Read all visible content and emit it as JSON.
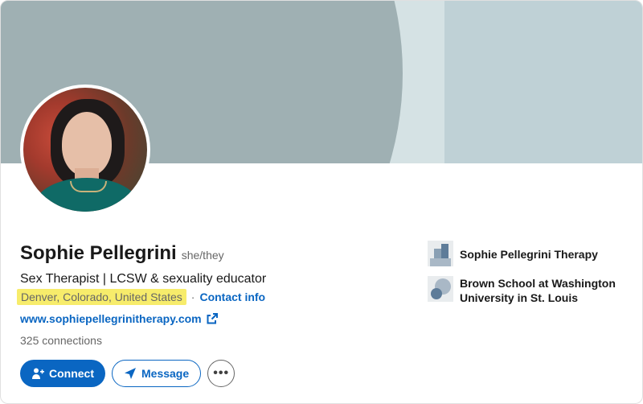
{
  "profile": {
    "name": "Sophie Pellegrini",
    "pronouns": "she/they",
    "headline": "Sex Therapist | LCSW & sexuality educator",
    "location": "Denver, Colorado, United States",
    "separator": "·",
    "contact_label": "Contact info",
    "website": "www.sophiepellegrinitherapy.com",
    "connections": "325 connections"
  },
  "actions": {
    "connect_label": "Connect",
    "message_label": "Message",
    "more_label": "•••"
  },
  "organizations": [
    {
      "name": "Sophie Pellegrini Therapy",
      "icon": "company-logo-icon"
    },
    {
      "name": "Brown School at Washington University in St. Louis",
      "icon": "school-logo-icon"
    }
  ],
  "colors": {
    "accent": "#0a66c2",
    "highlight": "#f7ec6b",
    "banner_dark": "#9fb0b3",
    "banner_light": "#bfd1d6"
  }
}
